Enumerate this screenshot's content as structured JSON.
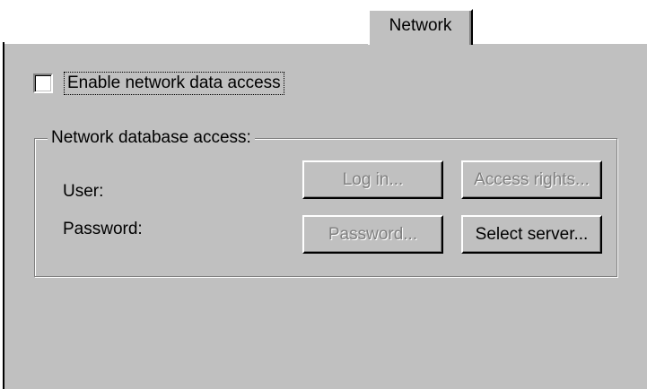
{
  "tab": {
    "label": "Network"
  },
  "enable_checkbox": {
    "label": "Enable network data access",
    "checked": false
  },
  "group": {
    "title": "Network database access:",
    "user_label": "User:",
    "password_label": "Password:"
  },
  "buttons": {
    "log_in": {
      "label": "Log in...",
      "enabled": false
    },
    "access_rights": {
      "label": "Access rights...",
      "enabled": false
    },
    "password": {
      "label": "Password...",
      "enabled": false
    },
    "select_server": {
      "label": "Select server...",
      "enabled": true
    }
  }
}
